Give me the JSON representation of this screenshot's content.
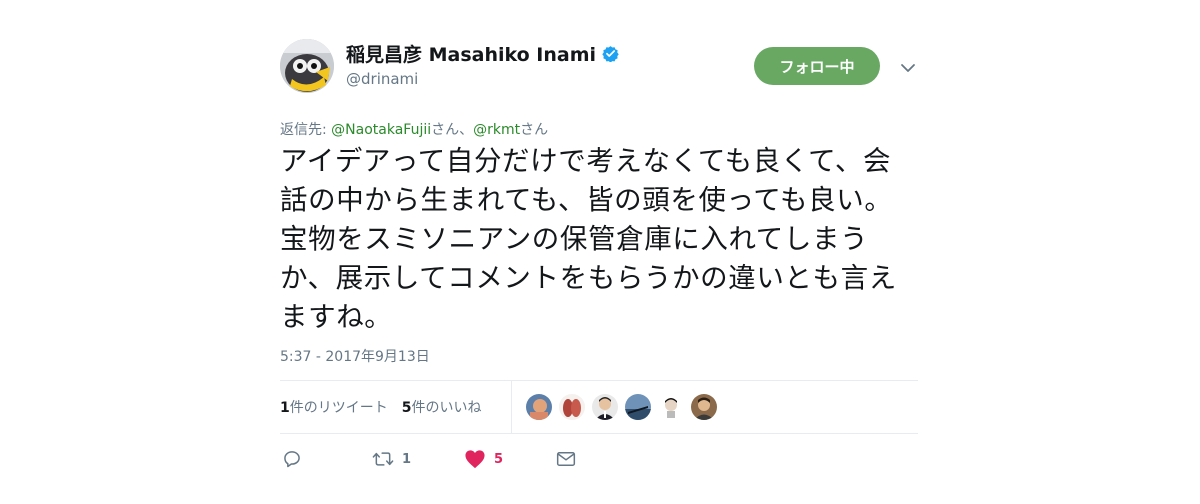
{
  "author": {
    "display_name": "稲見昌彦 Masahiko Inami",
    "handle": "@drinami",
    "verified": true
  },
  "follow_button": {
    "label": "フォロー中"
  },
  "reply_to": {
    "prefix": "返信先: ",
    "user1": "@NaotakaFujii",
    "suffix1": "さん、",
    "user2": "@rkmt",
    "suffix2": "さん"
  },
  "tweet": {
    "text": "アイデアって自分だけで考えなくても良くて、会話の中から生まれても、皆の頭を使っても良い。宝物をスミソニアンの保管倉庫に入れてしまうか、展示してコメントをもらうかの違いとも言えますね。",
    "timestamp": "5:37 - 2017年9月13日"
  },
  "stats": {
    "retweets_count": "1",
    "retweets_label": "件のリツイート",
    "likes_count": "5",
    "likes_label": "件のいいね"
  },
  "actions": {
    "retweet_count": "1",
    "like_count": "5"
  },
  "colors": {
    "follow_green": "#69a863",
    "like_red": "#e0245e",
    "verified_blue": "#1da1f2",
    "link_green": "#2b8a2b"
  },
  "icons": [
    "reply-icon",
    "retweet-icon",
    "heart-icon",
    "message-icon",
    "verified-icon",
    "chevron-down-icon"
  ]
}
